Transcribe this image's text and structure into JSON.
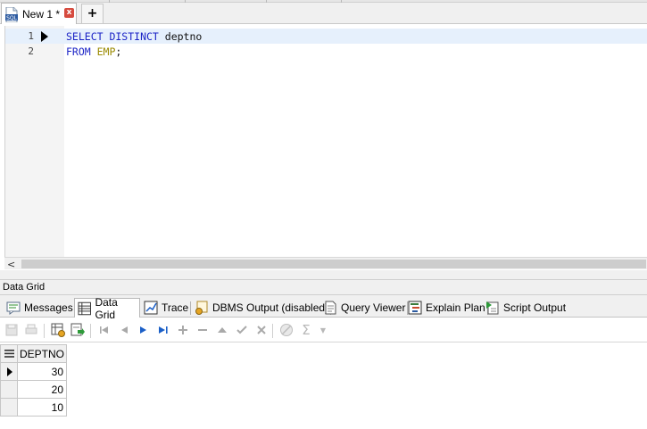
{
  "tab": {
    "label": "New 1 *",
    "icon": "sql-file-icon",
    "close_glyph": "x",
    "add_glyph": "+"
  },
  "editor": {
    "lines": [
      {
        "number": "1",
        "tokens": [
          {
            "t": "SELECT DISTINCT ",
            "k": "kw"
          },
          {
            "t": "deptno",
            "k": "plain"
          }
        ]
      },
      {
        "number": "2",
        "tokens": [
          {
            "t": "FROM ",
            "k": "kw"
          },
          {
            "t": "EMP",
            "k": "obj"
          },
          {
            "t": ";",
            "k": "plain"
          }
        ]
      }
    ],
    "colors": {
      "keyword": "#1c24c6",
      "object": "#9a8a00",
      "current_line": "#e6f0fc"
    }
  },
  "scrollbar": {
    "left_arrow": "<"
  },
  "panel": {
    "title": "Data Grid",
    "tabs": [
      {
        "label": "Messages",
        "icon": "messages-icon"
      },
      {
        "label": "Data Grid",
        "icon": "data-grid-icon",
        "active": true
      },
      {
        "label": "Trace",
        "icon": "trace-icon"
      },
      {
        "label": "DBMS Output (disabled)",
        "icon": "dbms-output-icon"
      },
      {
        "label": "Query Viewer",
        "icon": "query-viewer-icon"
      },
      {
        "label": "Explain Plan",
        "icon": "explain-plan-icon"
      },
      {
        "label": "Script Output",
        "icon": "script-output-icon"
      }
    ]
  },
  "toolbar": {
    "buttons": [
      "save-icon",
      "print-icon",
      "refresh-grid-icon",
      "export-icon",
      "first-record-icon",
      "prior-record-icon",
      "next-record-icon",
      "last-record-icon",
      "insert-record-icon",
      "delete-record-icon",
      "edit-record-icon",
      "post-edit-icon",
      "cancel-edit-icon",
      "filter-icon",
      "sum-icon"
    ],
    "sum_glyph": "Σ"
  },
  "grid": {
    "columns": [
      "DEPTNO"
    ],
    "rows": [
      [
        "30"
      ],
      [
        "20"
      ],
      [
        "10"
      ]
    ]
  }
}
